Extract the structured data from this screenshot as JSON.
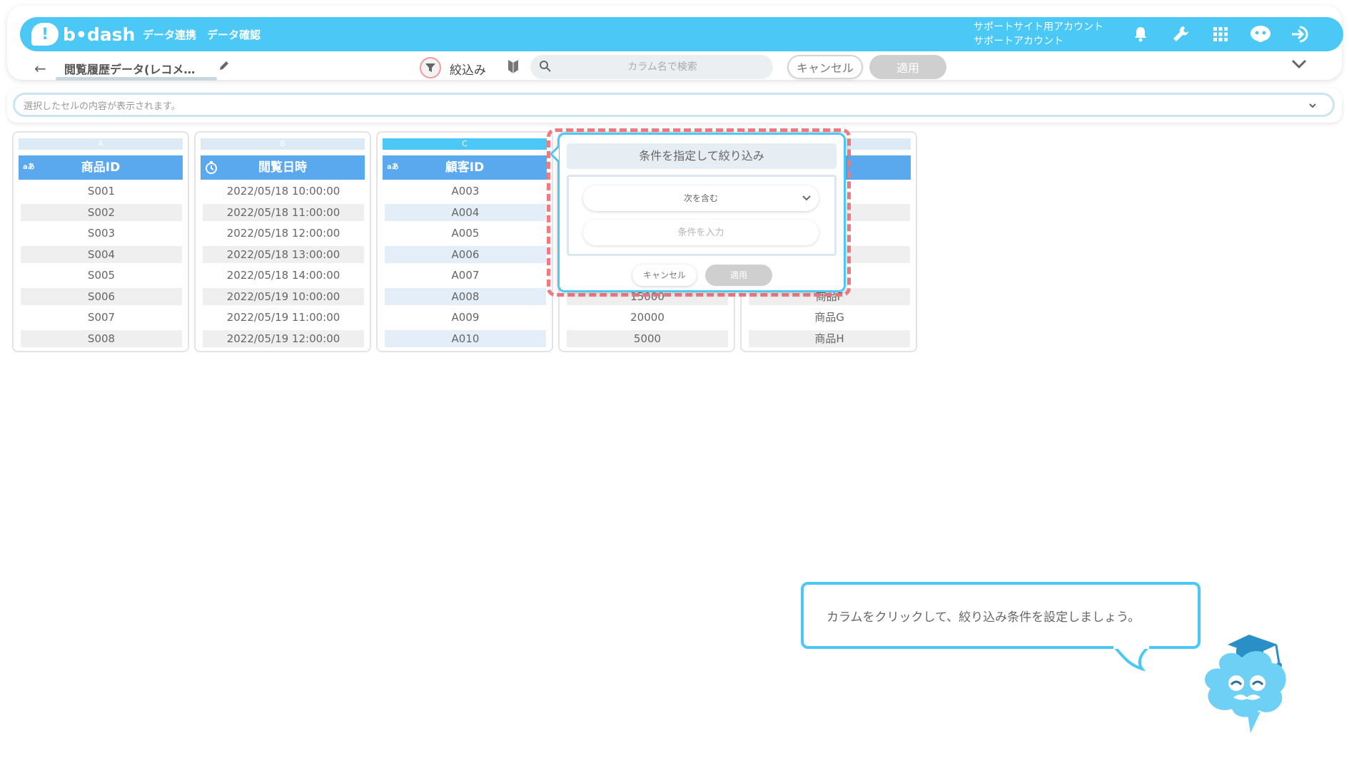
{
  "colors": {
    "accent": "#4cc8f6",
    "header_blue": "#5aa9ef",
    "highlight": "#f07a82"
  },
  "header": {
    "logo_text": "b•dash",
    "logo_mark": "!",
    "nav": [
      "データ連携",
      "データ確認"
    ],
    "account_line1": "サポートサイト用アカウント",
    "account_line2": "サポートアカウント",
    "icons": [
      "bell-icon",
      "wrench-icon",
      "grid-icon",
      "mascot-icon",
      "logout-icon"
    ]
  },
  "toolbar": {
    "back": "←",
    "title": "閲覧履歴データ(レコメ…",
    "filter_label": "絞込み",
    "search_placeholder": "カラム名で検索",
    "cancel": "キャンセル",
    "apply": "適用"
  },
  "cellbar": {
    "placeholder": "選択したセルの内容が表示されます。"
  },
  "columns": [
    {
      "letter": "A",
      "type": "aあ",
      "name": "商品ID",
      "cells": [
        "S001",
        "S002",
        "S003",
        "S004",
        "S005",
        "S006",
        "S007",
        "S008"
      ]
    },
    {
      "letter": "B",
      "type": "clock",
      "name": "閲覧日時",
      "cells": [
        "2022/05/18 10:00:00",
        "2022/05/18 11:00:00",
        "2022/05/18 12:00:00",
        "2022/05/18 13:00:00",
        "2022/05/18 14:00:00",
        "2022/05/19 10:00:00",
        "2022/05/19 11:00:00",
        "2022/05/19 12:00:00"
      ]
    },
    {
      "letter": "C",
      "type": "aあ",
      "name": "顧客ID",
      "cells": [
        "A003",
        "A004",
        "A005",
        "A006",
        "A007",
        "A008",
        "A009",
        "A010"
      ]
    },
    {
      "cells_visible": [
        "15000",
        "20000",
        "5000"
      ]
    },
    {
      "cells_visible": [
        "商品F",
        "商品G",
        "商品H"
      ]
    }
  ],
  "filter_popup": {
    "title": "条件を指定して絞り込み",
    "condition": "次を含む",
    "input_placeholder": "条件を入力",
    "cancel": "キャンセル",
    "apply": "適用"
  },
  "tutorial": {
    "message": "カラムをクリックして、絞り込み条件を設定しましょう。"
  }
}
